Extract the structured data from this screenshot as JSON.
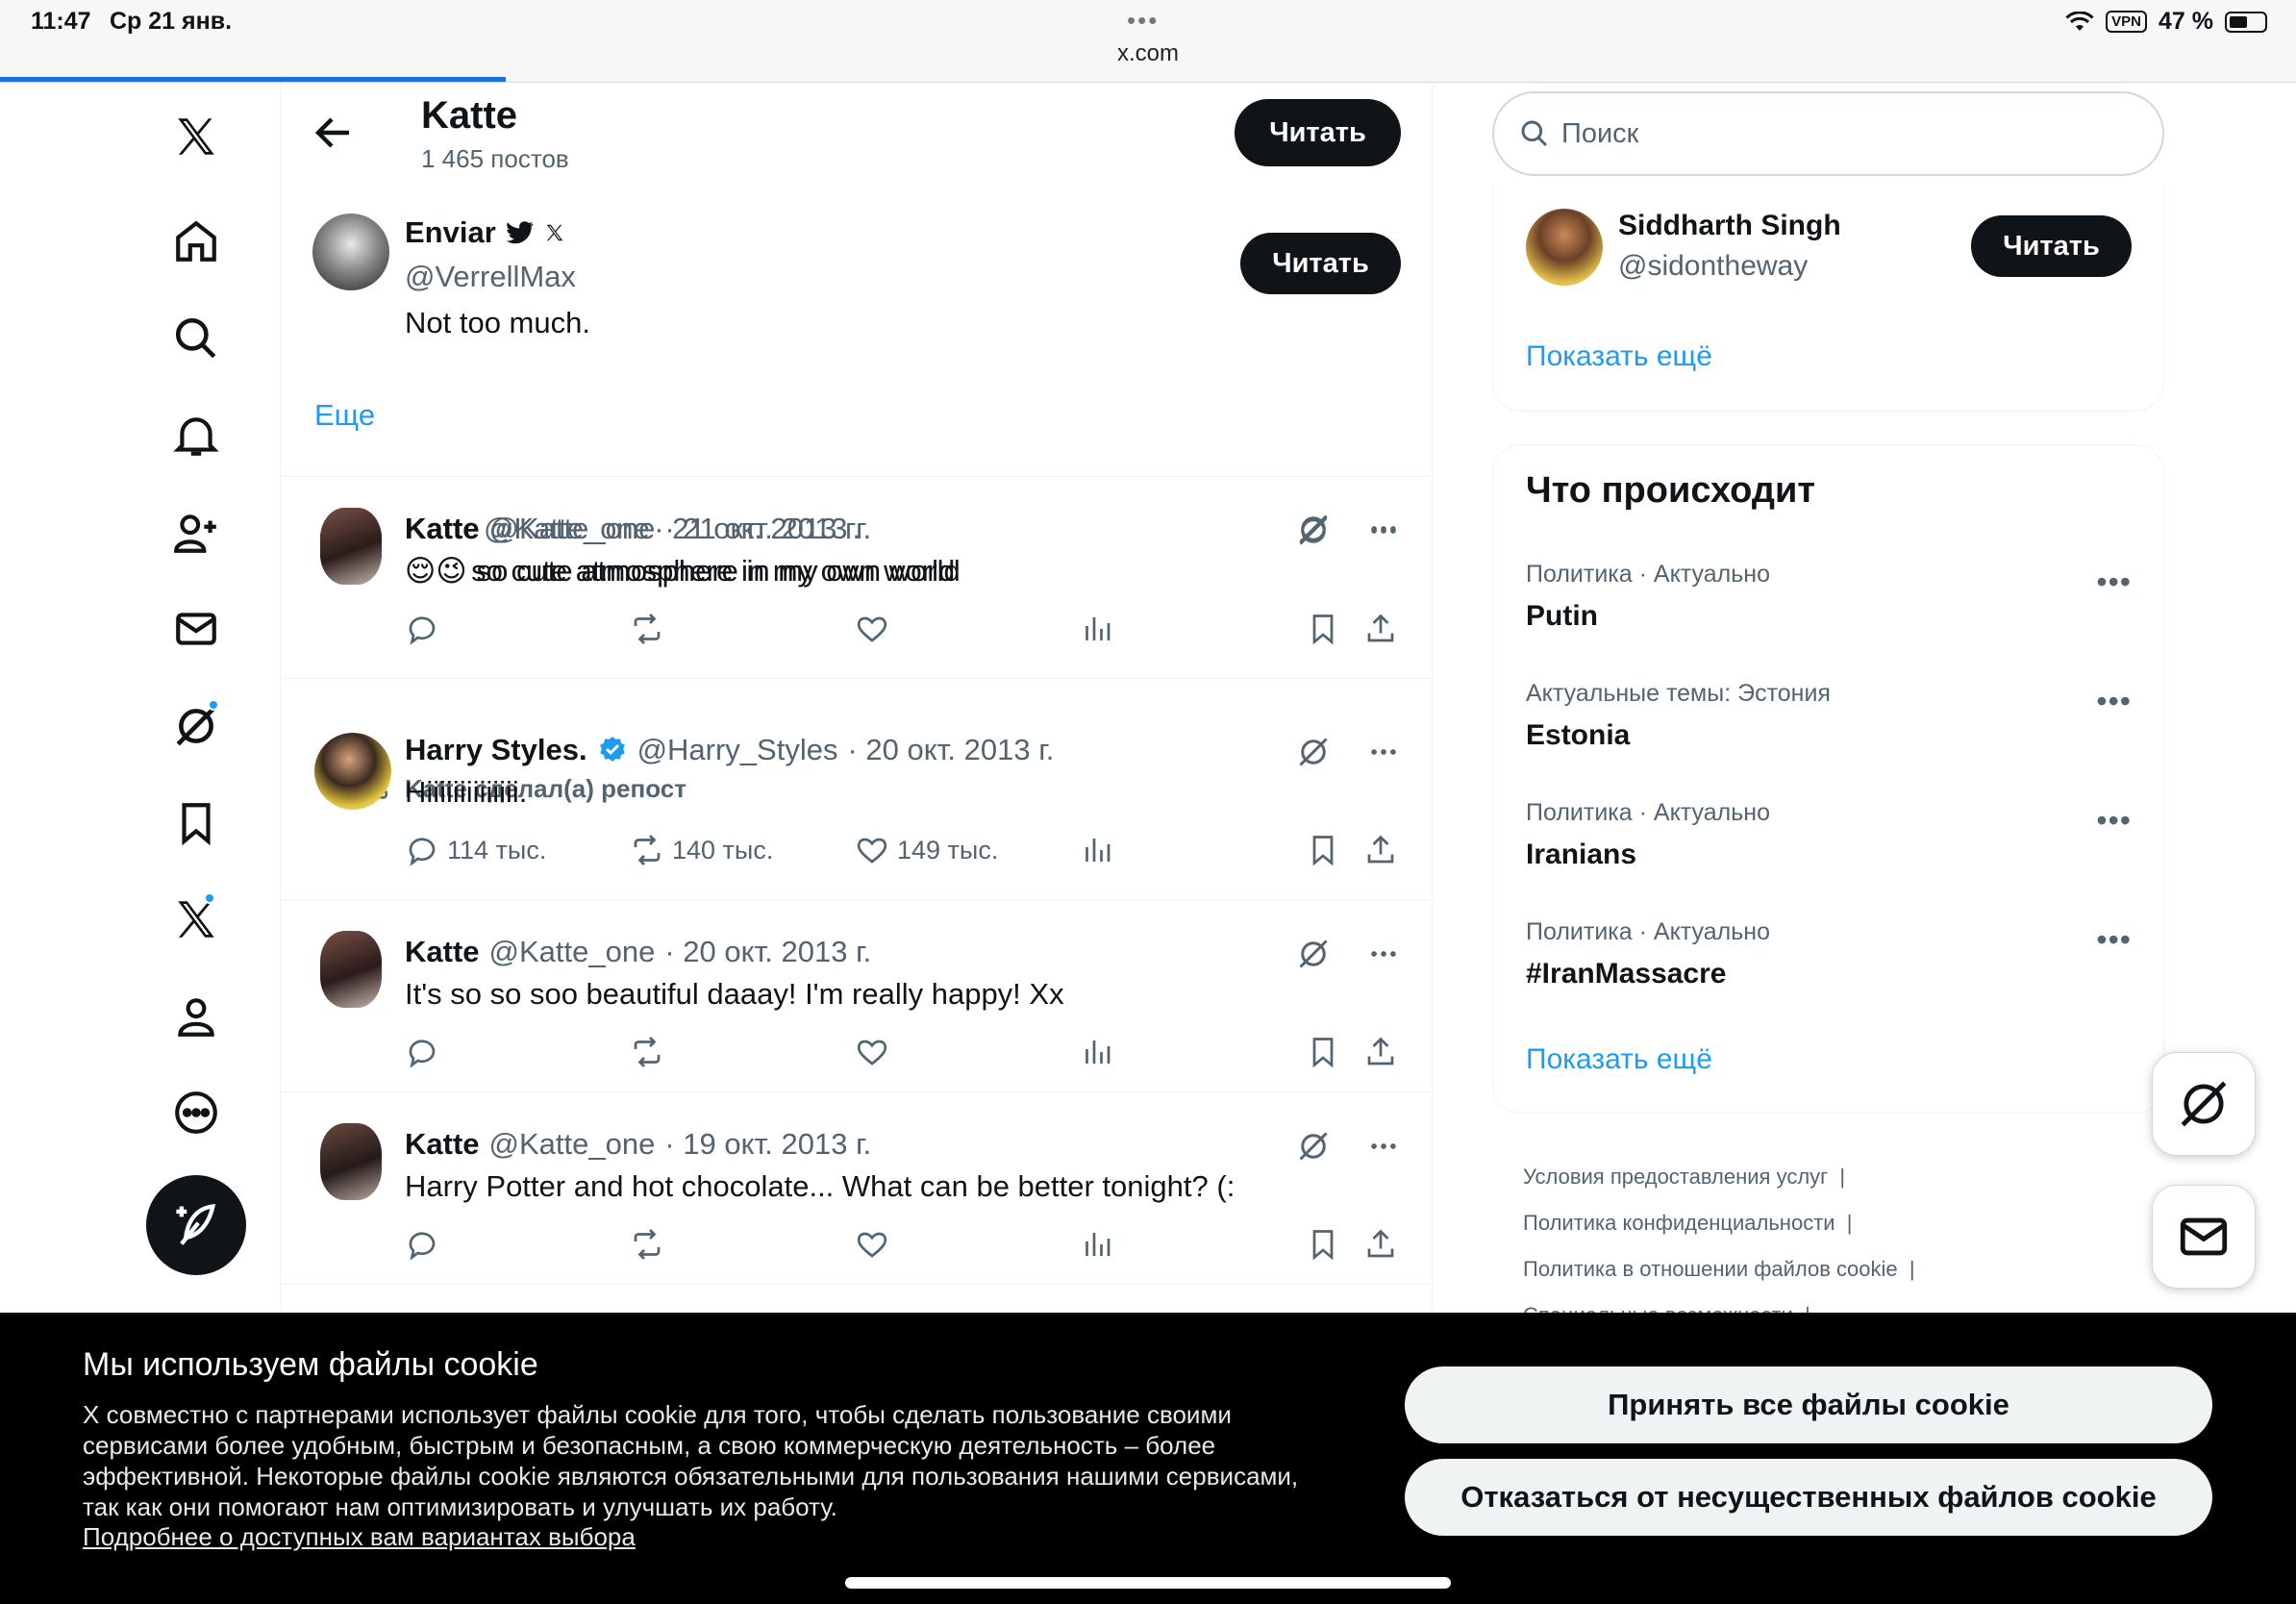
{
  "status_bar": {
    "time": "11:47",
    "date": "Ср 21 янв.",
    "url": "x.com",
    "vpn": "VPN",
    "battery": "47 %"
  },
  "header": {
    "name": "Katte",
    "posts_count": "1 465 постов",
    "follow_label": "Читать"
  },
  "reply_card": {
    "name": "Enviar",
    "handle": "@VerrellMax",
    "text": "Not too much.",
    "follow_label": "Читать",
    "more_label": "Еще"
  },
  "tweets": [
    {
      "name": "Katte",
      "handle": "@Katte_one",
      "date": "· 21 окт. 2013 г.",
      "emoji": "😌😉",
      "text": "so cute atmosphere in my own world",
      "replies": "",
      "reposts": "",
      "likes": ""
    },
    {
      "repost_label": "Katte сделал(а) репост",
      "name": "Harry Styles.",
      "handle": "@Harry_Styles",
      "date": "· 20 окт. 2013 г.",
      "text": "Hiiiiiiiiiiiiii.",
      "replies": "114 тыс.",
      "reposts": "140 тыс.",
      "likes": "149 тыс."
    },
    {
      "name": "Katte",
      "handle": "@Katte_one",
      "date": "· 20 окт. 2013 г.",
      "text": "It's so so soo beautiful daaay! I'm really happy! Xx",
      "replies": "",
      "reposts": "",
      "likes": ""
    },
    {
      "name": "Katte",
      "handle": "@Katte_one",
      "date": "· 19 окт. 2013 г.",
      "text": "Harry Potter and hot chocolate... What can be better tonight? (:",
      "replies": "",
      "reposts": "",
      "likes": ""
    }
  ],
  "right": {
    "search_placeholder": "Поиск",
    "who_to_follow": {
      "name": "Siddharth Singh",
      "handle": "@sidontheway",
      "follow_label": "Читать",
      "show_more": "Показать ещё"
    },
    "trends_title": "Что происходит",
    "trends": [
      {
        "category": "Политика · Актуально",
        "title": "Putin"
      },
      {
        "category": "Актуальные темы: Эстония",
        "title": "Estonia"
      },
      {
        "category": "Политика · Актуально",
        "title": "Iranians"
      },
      {
        "category": "Политика · Актуально",
        "title": "#IranMassacre"
      }
    ],
    "trends_show_more": "Показать ещё",
    "footer": [
      "Условия предоставления услуг",
      "Политика конфиденциальности",
      "Политика в отношении файлов cookie",
      "Специальные возможности"
    ]
  },
  "cookie": {
    "title": "Мы используем файлы cookie",
    "text": "X совместно с партнерами использует файлы cookie для того, чтобы сделать пользование своими сервисами более удобным, быстрым и безопасным, а свою коммерческую деятельность – более эффективной. Некоторые файлы cookie являются обязательными для пользования нашими сервисами, так как они помогают нам оптимизировать и улучшать их работу.",
    "link": "Подробнее о доступных вам вариантах выбора",
    "accept_label": "Принять все файлы cookie",
    "reject_label": "Отказаться от несущественных файлов cookie"
  },
  "colors": {
    "accent": "#1d9bf0",
    "text": "#0f1419",
    "muted": "#536471",
    "banner": "#000000"
  }
}
